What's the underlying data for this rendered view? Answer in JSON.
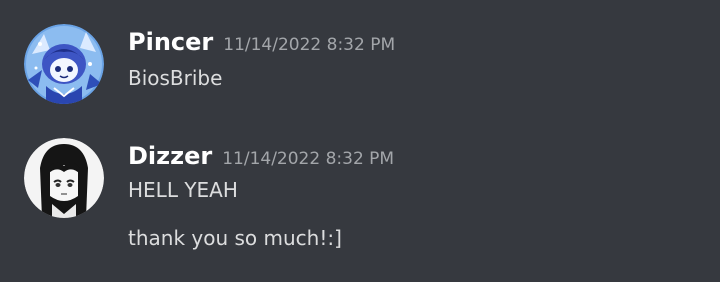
{
  "messages": [
    {
      "author": "Pincer",
      "timestamp": "11/14/2022 8:32 PM",
      "avatar_icon": "anime-avatar-blue",
      "lines": [
        "BiosBribe"
      ]
    },
    {
      "author": "Dizzer",
      "timestamp": "11/14/2022 8:32 PM",
      "avatar_icon": "anime-avatar-monochrome",
      "lines": [
        "HELL YEAH",
        "thank you so much!:]"
      ]
    }
  ],
  "colors": {
    "background": "#36393f",
    "username": "#ffffff",
    "timestamp": "#a3a6aa",
    "message_text": "#dcddde"
  }
}
